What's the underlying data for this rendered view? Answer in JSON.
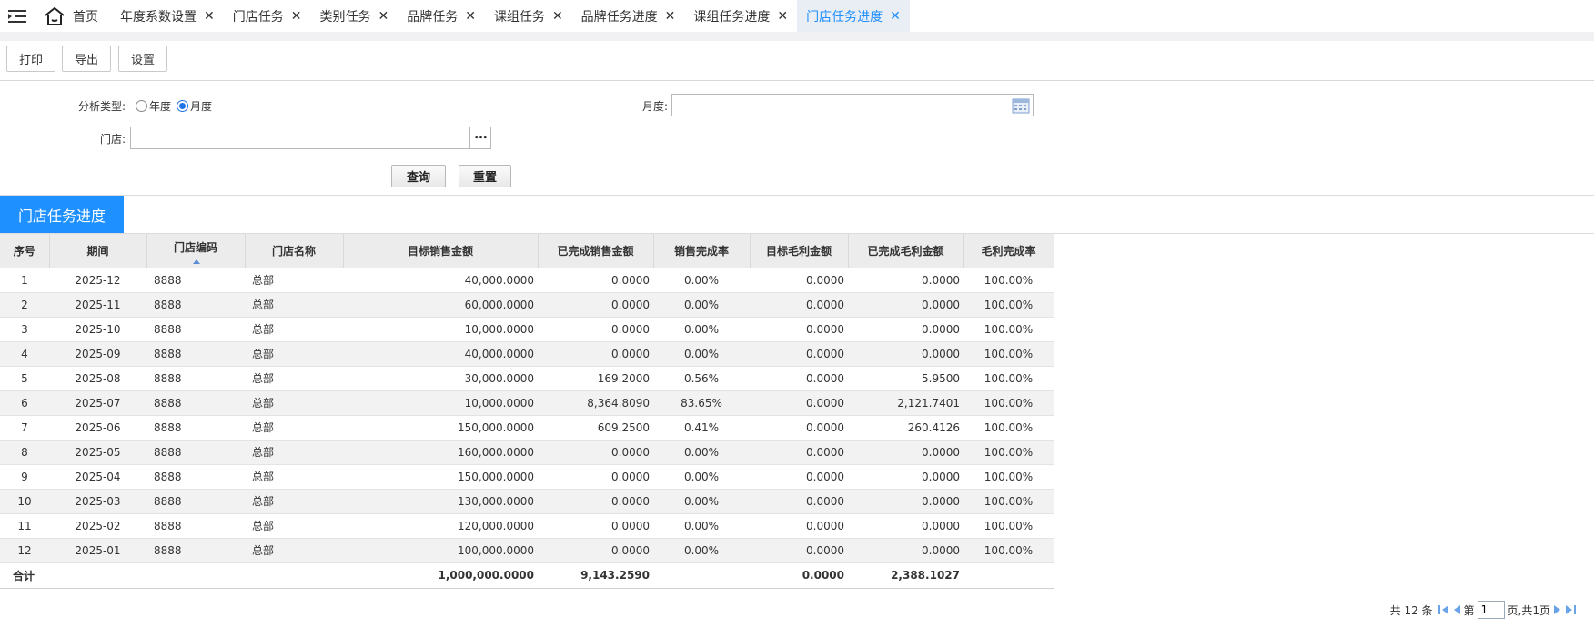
{
  "tabs": {
    "home_label": "首页",
    "items": [
      {
        "label": "年度系数设置",
        "active": false
      },
      {
        "label": "门店任务",
        "active": false
      },
      {
        "label": "类别任务",
        "active": false
      },
      {
        "label": "品牌任务",
        "active": false
      },
      {
        "label": "课组任务",
        "active": false
      },
      {
        "label": "品牌任务进度",
        "active": false
      },
      {
        "label": "课组任务进度",
        "active": false
      },
      {
        "label": "门店任务进度",
        "active": true
      }
    ],
    "close_glyph": "✕"
  },
  "toolbar": {
    "print_label": "打印",
    "export_label": "导出",
    "settings_label": "设置"
  },
  "filter": {
    "analysis_type_label": "分析类型:",
    "option_year": "年度",
    "option_month": "月度",
    "selected": "月度",
    "month_label": "月度:",
    "month_value": "",
    "store_label": "门店:",
    "store_value": "",
    "lookup_glyph": "•••",
    "query_label": "查询",
    "reset_label": "重置"
  },
  "section_title": "门店任务进度",
  "grid": {
    "columns": [
      "序号",
      "期间",
      "门店编码",
      "门店名称",
      "目标销售金额",
      "已完成销售金额",
      "销售完成率",
      "目标毛利金额",
      "已完成毛利金额",
      "毛利完成率"
    ],
    "sorted_column": "门店编码",
    "rows": [
      [
        "1",
        "2025-12",
        "8888",
        "总部",
        "40,000.0000",
        "0.0000",
        "0.00%",
        "0.0000",
        "0.0000",
        "100.00%"
      ],
      [
        "2",
        "2025-11",
        "8888",
        "总部",
        "60,000.0000",
        "0.0000",
        "0.00%",
        "0.0000",
        "0.0000",
        "100.00%"
      ],
      [
        "3",
        "2025-10",
        "8888",
        "总部",
        "10,000.0000",
        "0.0000",
        "0.00%",
        "0.0000",
        "0.0000",
        "100.00%"
      ],
      [
        "4",
        "2025-09",
        "8888",
        "总部",
        "40,000.0000",
        "0.0000",
        "0.00%",
        "0.0000",
        "0.0000",
        "100.00%"
      ],
      [
        "5",
        "2025-08",
        "8888",
        "总部",
        "30,000.0000",
        "169.2000",
        "0.56%",
        "0.0000",
        "5.9500",
        "100.00%"
      ],
      [
        "6",
        "2025-07",
        "8888",
        "总部",
        "10,000.0000",
        "8,364.8090",
        "83.65%",
        "0.0000",
        "2,121.7401",
        "100.00%"
      ],
      [
        "7",
        "2025-06",
        "8888",
        "总部",
        "150,000.0000",
        "609.2500",
        "0.41%",
        "0.0000",
        "260.4126",
        "100.00%"
      ],
      [
        "8",
        "2025-05",
        "8888",
        "总部",
        "160,000.0000",
        "0.0000",
        "0.00%",
        "0.0000",
        "0.0000",
        "100.00%"
      ],
      [
        "9",
        "2025-04",
        "8888",
        "总部",
        "150,000.0000",
        "0.0000",
        "0.00%",
        "0.0000",
        "0.0000",
        "100.00%"
      ],
      [
        "10",
        "2025-03",
        "8888",
        "总部",
        "130,000.0000",
        "0.0000",
        "0.00%",
        "0.0000",
        "0.0000",
        "100.00%"
      ],
      [
        "11",
        "2025-02",
        "8888",
        "总部",
        "120,000.0000",
        "0.0000",
        "0.00%",
        "0.0000",
        "0.0000",
        "100.00%"
      ],
      [
        "12",
        "2025-01",
        "8888",
        "总部",
        "100,000.0000",
        "0.0000",
        "0.00%",
        "0.0000",
        "0.0000",
        "100.00%"
      ]
    ],
    "total": {
      "label": "合计",
      "target_sales": "1,000,000.0000",
      "completed_sales": "9,143.2590",
      "target_profit": "0.0000",
      "completed_profit": "2,388.1027"
    }
  },
  "pager": {
    "total_text": "共 12 条",
    "page_prefix": "第",
    "page_value": "1",
    "page_suffix": "页,共1页"
  },
  "colors": {
    "accent": "#1e90ff",
    "active_tab_bg": "#e9edf4"
  }
}
